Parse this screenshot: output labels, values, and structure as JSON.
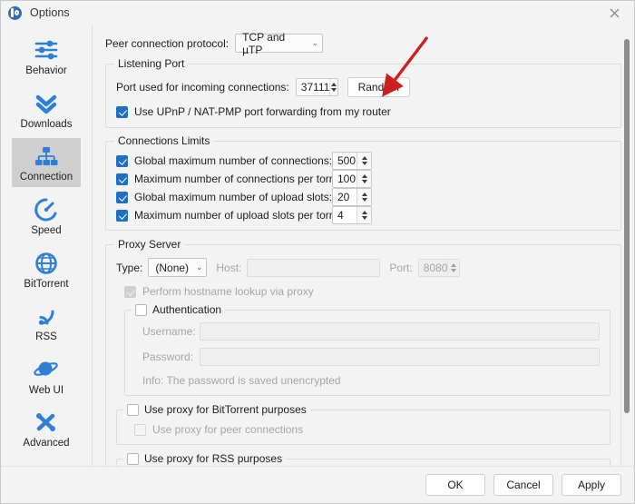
{
  "window": {
    "title": "Options",
    "logo_icon": "qbittorrent-logo-icon",
    "close_icon": "✕"
  },
  "sidebar": {
    "items": [
      {
        "label": "Behavior",
        "icon": "sliders-icon",
        "selected": false
      },
      {
        "label": "Downloads",
        "icon": "double-chevron-down-icon",
        "selected": false
      },
      {
        "label": "Connection",
        "icon": "network-icon",
        "selected": true
      },
      {
        "label": "Speed",
        "icon": "speedometer-icon",
        "selected": false
      },
      {
        "label": "BitTorrent",
        "icon": "globe-icon",
        "selected": false
      },
      {
        "label": "RSS",
        "icon": "rss-icon",
        "selected": false
      },
      {
        "label": "Web UI",
        "icon": "planet-icon",
        "selected": false
      },
      {
        "label": "Advanced",
        "icon": "tools-icon",
        "selected": false
      }
    ]
  },
  "main": {
    "peer_protocol": {
      "label": "Peer connection protocol:",
      "value": "TCP and µTP",
      "caret_icon": "chevron-down-icon"
    },
    "listening_port": {
      "title": "Listening Port",
      "port_label": "Port used for incoming connections:",
      "port_value": "37111",
      "random_button": "Random",
      "upnp_label": "Use UPnP / NAT-PMP port forwarding from my router",
      "upnp_checked": true
    },
    "connections_limits": {
      "title": "Connections Limits",
      "rows": [
        {
          "label": "Global maximum number of connections:",
          "value": "500",
          "checked": true
        },
        {
          "label": "Maximum number of connections per torrent:",
          "value": "100",
          "checked": true
        },
        {
          "label": "Global maximum number of upload slots:",
          "value": "20",
          "checked": true
        },
        {
          "label": "Maximum number of upload slots per torrent:",
          "value": "4",
          "checked": true
        }
      ]
    },
    "proxy_server": {
      "title": "Proxy Server",
      "type_label": "Type:",
      "type_value": "(None)",
      "host_label": "Host:",
      "host_value": "",
      "port_label": "Port:",
      "port_value": "8080",
      "hostname_lookup_label": "Perform hostname lookup via proxy",
      "hostname_lookup_checked": true,
      "authentication_label": "Authentication",
      "authentication_checked": false,
      "username_label": "Username:",
      "username_value": "",
      "password_label": "Password:",
      "password_value": "",
      "info_text": "Info: The password is saved unencrypted",
      "use_for_bittorrent_label": "Use proxy for BitTorrent purposes",
      "use_for_bittorrent_checked": false,
      "use_for_peers_label": "Use proxy for peer connections",
      "use_for_peers_checked": false,
      "use_for_rss_label": "Use proxy for RSS purposes",
      "use_for_rss_checked": false
    }
  },
  "annotation": {
    "arrow_color": "#cc1f1f",
    "arrow_name": "red-arrow-pointing-to-random-button"
  },
  "footer": {
    "ok": "OK",
    "cancel": "Cancel",
    "apply": "Apply"
  },
  "colors": {
    "accent_blue": "#1f6fc4",
    "icon_blue": "#2f7fd6",
    "window_bg": "#f3f3f3",
    "selected_item": "#cfcfcf"
  }
}
